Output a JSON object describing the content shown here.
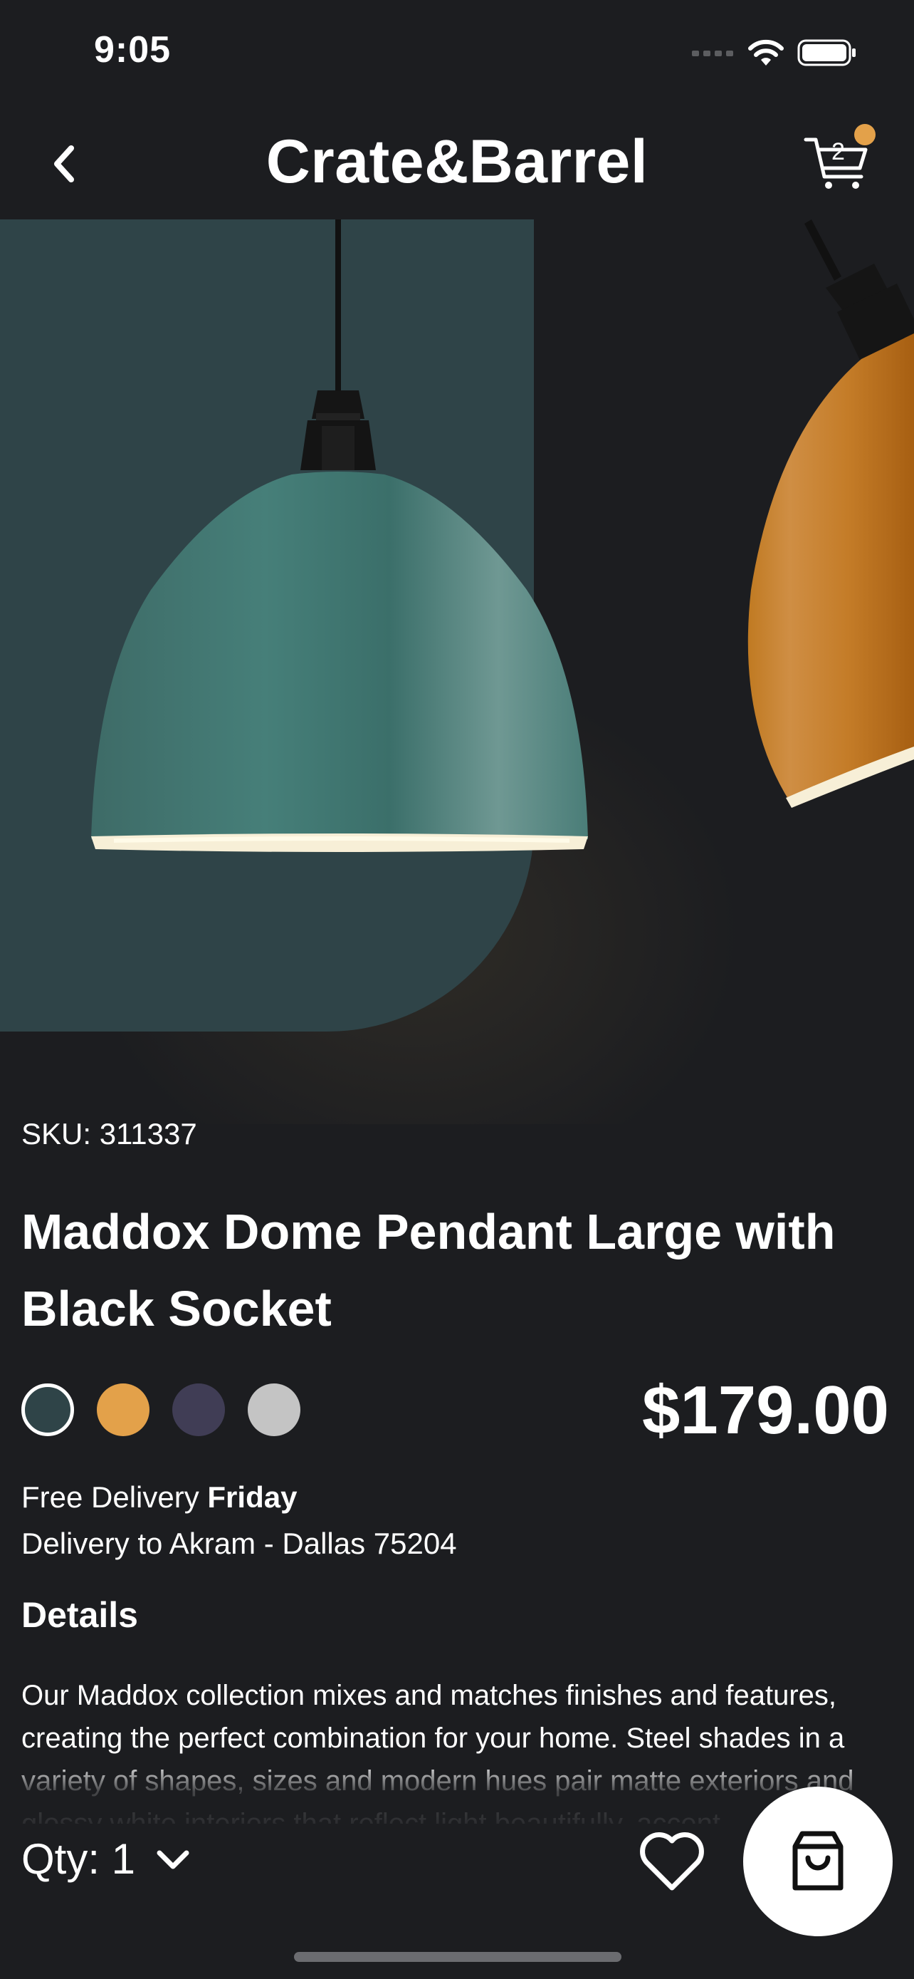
{
  "status_bar": {
    "time": "9:05"
  },
  "nav": {
    "brand": "Crate&Barrel",
    "cart_count": "2"
  },
  "product": {
    "sku": "SKU: 311337",
    "title": "Maddox Dome Pendant Large with Black Socket",
    "price": "$179.00",
    "swatches": [
      {
        "name": "dark-teal",
        "color": "#2f4448",
        "selected": true
      },
      {
        "name": "amber",
        "color": "#e3a14a",
        "selected": false
      },
      {
        "name": "slate-purple",
        "color": "#403d55",
        "selected": false
      },
      {
        "name": "light-gray",
        "color": "#c4c4c4",
        "selected": false
      }
    ],
    "delivery_prefix": "Free Delivery ",
    "delivery_day": "Friday",
    "delivery_address": "Delivery to Akram - Dallas 75204"
  },
  "details": {
    "heading": "Details",
    "body": "Our Maddox collection mixes and matches finishes and features, creating the perfect combination for your home. Steel shades in a variety of shapes, sizes and modern hues pair matte exteriors and glossy white interiors that reflect light beautifully, accent"
  },
  "bottom_bar": {
    "qty_label": "Qty: 1"
  },
  "icons": {
    "back": "chevron-left-icon",
    "cart": "cart-icon",
    "qty": "chevron-down-icon",
    "favorite": "heart-icon",
    "bag": "shopping-bag-icon"
  },
  "colors": {
    "accent": "#e3a14a",
    "background": "#1c1d20",
    "backdrop": "#2f4448"
  }
}
